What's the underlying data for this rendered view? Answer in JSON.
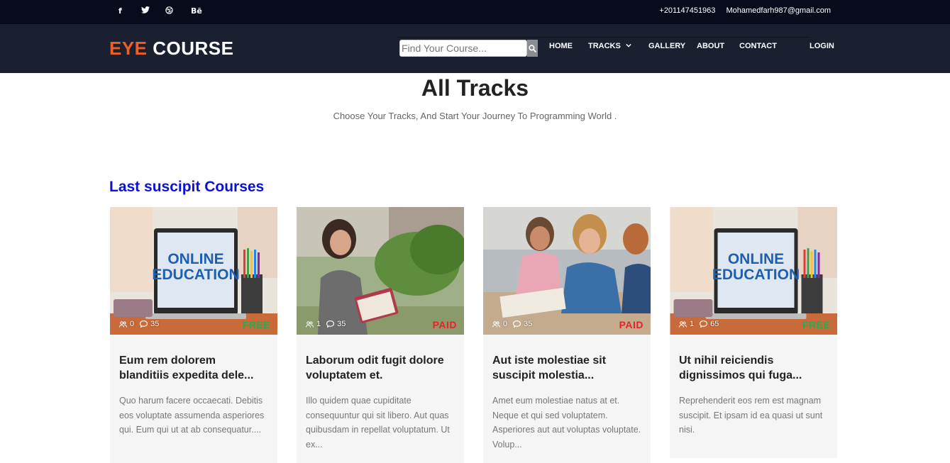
{
  "topbar": {
    "social": [
      {
        "name": "facebook-icon",
        "glyph": "f"
      },
      {
        "name": "twitter-icon",
        "glyph": "🐦"
      },
      {
        "name": "dribbble-icon",
        "glyph": "⊛"
      },
      {
        "name": "behance-icon",
        "glyph": "Bē"
      }
    ],
    "phone": "+201147451963",
    "email": "Mohamedfarh987@gmail.com"
  },
  "navbar": {
    "logo_accent": "EYE",
    "logo_rest": " COURSE",
    "search_placeholder": "Find Your Course...",
    "items": {
      "home": "HOME",
      "tracks": "TRACKS",
      "gallery": "GALLERY",
      "about": "ABOUT",
      "contact": "CONTACT",
      "login": "LOGIN"
    }
  },
  "hero": {
    "title": "All Tracks",
    "subtitle": "Choose Your Tracks, And Start Your Journey To Programming World ."
  },
  "section": {
    "title": "Last suscipit Courses"
  },
  "colors": {
    "accent": "#ef5e24",
    "section_title": "#0b12d6",
    "free": "#2fa84f",
    "paid": "#e3242b",
    "topbar": "#070b1c",
    "navbar": "#1b2031"
  },
  "cards": [
    {
      "image": "online-education-laptop",
      "students": "0",
      "comments": "35",
      "price": "FREE",
      "title": "Eum rem dolorem blanditiis expedita dele...",
      "desc": "Quo harum facere occaecati. Debitis eos voluptate assumenda asperiores qui. Eum qui ut at ab consequatur...."
    },
    {
      "image": "student-girl-outdoors",
      "students": "1",
      "comments": "35",
      "price": "PAID",
      "title": "Laborum odit fugit dolore voluptatem et.",
      "desc": "Illo quidem quae cupiditate consequuntur qui sit libero. Aut quas quibusdam in repellat voluptatum. Ut ex..."
    },
    {
      "image": "students-studying-table",
      "students": "0",
      "comments": "35",
      "price": "PAID",
      "title": "Aut iste molestiae sit suscipit molestia...",
      "desc": "Amet eum molestiae natus at et. Neque et qui sed voluptatem. Asperiores aut aut voluptas voluptate. Volup..."
    },
    {
      "image": "online-education-laptop",
      "students": "1",
      "comments": "65",
      "price": "FREE",
      "title": "Ut nihil reiciendis dignissimos qui fuga...",
      "desc": "Reprehenderit eos rem est magnam suscipit. Et ipsam id ea quasi ut sunt nisi."
    }
  ]
}
